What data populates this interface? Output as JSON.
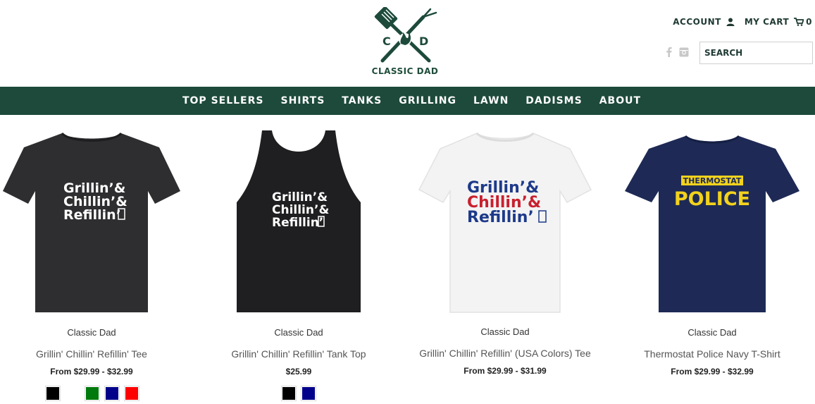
{
  "brand": {
    "logo_text": "CLASSIC DAD",
    "initial_left": "C",
    "initial_right": "D",
    "color": "#1d4a3b"
  },
  "header": {
    "account_label": "ACCOUNT",
    "cart_label": "MY CART",
    "cart_count": "0",
    "search_placeholder": "SEARCH",
    "icons": [
      "user-icon",
      "cart-icon",
      "facebook-icon",
      "instagram-icon"
    ]
  },
  "nav": {
    "items": [
      "TOP SELLERS",
      "SHIRTS",
      "TANKS",
      "GRILLING",
      "LAWN",
      "DADISMS",
      "ABOUT"
    ],
    "bg_color": "#1d4a3b"
  },
  "products": [
    {
      "vendor": "Classic Dad",
      "title": "Grillin' Chillin' Refillin' Tee",
      "price": "From $29.99 - $32.99",
      "art_lines": [
        "Grillin’&",
        "Chillin’&",
        "Refillin’"
      ],
      "swatches": [
        "#000000",
        "#ffffff",
        "#007a0c",
        "#00008a",
        "#ff0000"
      ]
    },
    {
      "vendor": "Classic Dad",
      "title": "Grillin' Chillin' Refillin' Tank Top",
      "price": "$25.99",
      "art_lines": [
        "Grillin’&",
        "Chillin’&",
        "Refillin’"
      ],
      "swatches": [
        "#000000",
        "#00008a"
      ]
    },
    {
      "vendor": "Classic Dad",
      "title": "Grillin' Chillin' Refillin' (USA Colors) Tee",
      "price": "From $29.99 - $31.99",
      "art_lines": [
        "Grillin’&",
        "Chillin’&",
        "Refillin’"
      ],
      "swatches": []
    },
    {
      "vendor": "Classic Dad",
      "title": "Thermostat Police Navy T-Shirt",
      "price": "From $29.99 - $32.99",
      "art_lines": [
        "THERMOSTAT",
        "POLICE"
      ],
      "swatches": []
    }
  ]
}
